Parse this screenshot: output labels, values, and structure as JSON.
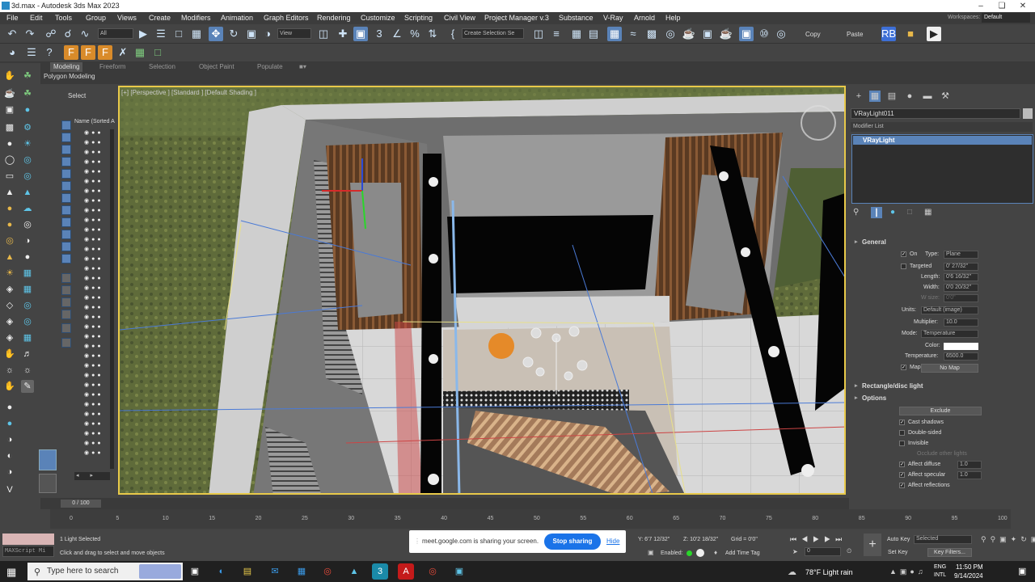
{
  "window": {
    "title": "3d.max - Autodesk 3ds Max 2023"
  },
  "menu": [
    "File",
    "Edit",
    "Tools",
    "Group",
    "Views",
    "Create",
    "Modifiers",
    "Animation",
    "Graph Editors",
    "Rendering",
    "Customize",
    "Scripting",
    "Civil View",
    "Project Manager v.3",
    "Substance",
    "V-Ray",
    "Arnold",
    "Help"
  ],
  "workspaces": {
    "label": "Workspaces:",
    "value": "Default"
  },
  "toolbar": {
    "filter": "All",
    "view": "View",
    "selset": "Create Selection Se",
    "copy": "Copy",
    "paste": "Paste"
  },
  "ribbon": {
    "tabs": [
      "Modeling",
      "Freeform",
      "Selection",
      "Object Paint",
      "Populate"
    ],
    "sub": "Polygon Modeling"
  },
  "scene": {
    "select": "Select",
    "name_header": "Name (Sorted A"
  },
  "viewport": {
    "label": "[+] [Perspective ] [Standard ] [Default Shading ]"
  },
  "cmd": {
    "object": "VRayLight011",
    "modifier_list": "Modifier List",
    "stack_item": "VRayLight",
    "general": {
      "title": "General",
      "on": "On",
      "type_label": "Type:",
      "type": "Plane",
      "targeted": "Targeted",
      "targeted_val": "0' 27/32\"",
      "length_label": "Length:",
      "length": "0'6 16/32\"",
      "width_label": "Width:",
      "width": "0'0 20/32\"",
      "wsize_label": "W size:",
      "wsize": "0'0\"",
      "units_label": "Units:",
      "units": "Default (image)",
      "mult_label": "Multiplier:",
      "mult": "10.0",
      "mode_label": "Mode:",
      "mode": "Temperature",
      "color_label": "Color:",
      "temp_label": "Temperature:",
      "temp": "6500.0",
      "map": "Map",
      "nomap": "No Map"
    },
    "rect": "Rectangle/disc light",
    "options": {
      "title": "Options",
      "exclude": "Exclude",
      "cast": "Cast shadows",
      "double": "Double-sided",
      "invisible": "Invisible",
      "occlude": "Occlude other lights",
      "diffuse": "Affect diffuse",
      "diffuse_val": "1.0",
      "specular": "Affect specular",
      "specular_val": "1.0",
      "reflections": "Affect reflections"
    }
  },
  "timeline": {
    "frame": "0 / 100",
    "ticks": [
      "0",
      "5",
      "10",
      "15",
      "20",
      "25",
      "30",
      "35",
      "40",
      "45",
      "50",
      "55",
      "60",
      "65",
      "70",
      "75",
      "80",
      "85",
      "90",
      "95",
      "100"
    ]
  },
  "status": {
    "sel": "1 Light Selected",
    "hint": "Click and drag to select and move objects",
    "script": "MAXScript Mi",
    "y": "Y: 6'7 12/32\"",
    "z": "Z: 10'2 18/32\"",
    "grid": "Grid = 0'0\"",
    "enabled": "Enabled:",
    "addtime": "Add Time Tag",
    "autokey": "Auto Key",
    "selected": "Selected",
    "setkey": "Set Key",
    "keyfilters": "Key Filters...",
    "frame_val": "0"
  },
  "share": {
    "msg": "meet.google.com is sharing your screen.",
    "stop": "Stop sharing",
    "hide": "Hide"
  },
  "taskbar": {
    "search": "Type here to search",
    "weather": "78°F  Light rain",
    "time": "11:50 PM",
    "date": "9/14/2024",
    "lang1": "ENG",
    "lang2": "INTL"
  }
}
